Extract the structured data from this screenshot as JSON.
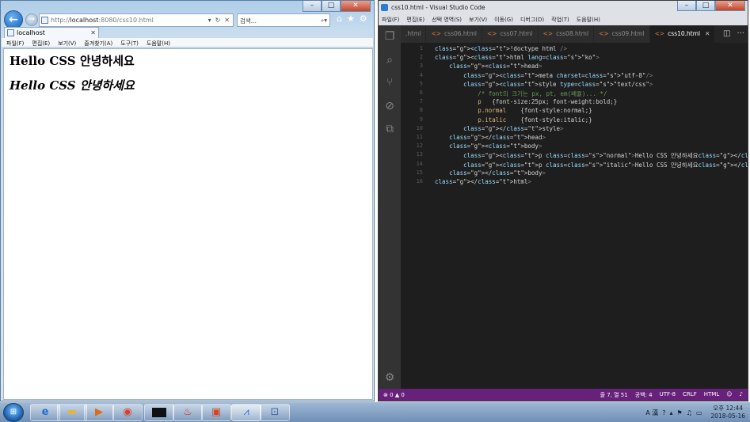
{
  "ie": {
    "address": {
      "prefix": "http://",
      "host": "localhost",
      "rest": ":8080/css10.html"
    },
    "search_placeholder": "검색...",
    "tab_title": "localhost",
    "menu": [
      "파일(F)",
      "편집(E)",
      "보기(V)",
      "즐겨찾기(A)",
      "도구(T)",
      "도움말(H)"
    ],
    "content": {
      "normal_text": "Hello CSS 안녕하세요",
      "italic_text": "Hello CSS 안녕하세요"
    }
  },
  "vscode": {
    "title": "css10.html - Visual Studio Code",
    "menu": [
      "파일(F)",
      "편집(E)",
      "선택 영역(S)",
      "보기(V)",
      "이동(G)",
      "디버그(D)",
      "작업(T)",
      "도움말(H)"
    ],
    "tabs": [
      {
        "label": ".html",
        "icon": "<>"
      },
      {
        "label": "css06.html",
        "icon": "<>"
      },
      {
        "label": "css07.html",
        "icon": "<>"
      },
      {
        "label": "css08.html",
        "icon": "<>"
      },
      {
        "label": "css09.html",
        "icon": "<>"
      },
      {
        "label": "css10.html",
        "icon": "<>",
        "active": true
      }
    ],
    "line_numbers": [
      "1",
      "2",
      "3",
      "4",
      "5",
      "6",
      "7",
      "8",
      "9",
      "10",
      "11",
      "12",
      "13",
      "14",
      "15",
      "16"
    ],
    "code_lines": [
      "<!doctype html />",
      "<html lang=\"ko\">",
      "    <head>",
      "        <meta charset=\"utf-8\"/>",
      "        <style type=\"text/css\">",
      "            /* font의 크기는 px, pt, em(배율)... */",
      "            p   {font-size:25px; font-weight:bold;}",
      "            p.normal    {font-style:normal;}",
      "            p.italic    {font-style:italic;}",
      "        </style>",
      "    </head>",
      "    <body>",
      "        <p class=\"normal\">Hello CSS 안녕하세요</p>",
      "        <p class=\"italic\">Hello CSS 안녕하세요</p>",
      "    </body>",
      "</html>"
    ],
    "status": {
      "problems": "⊗ 0 ▲ 0",
      "position": "줄 7, 열 51",
      "spaces": "공백: 4",
      "encoding": "UTF-8",
      "eol": "CRLF",
      "language": "HTML"
    }
  },
  "taskbar": {
    "apps": [
      "internet-explorer",
      "file-explorer",
      "media-player",
      "chrome",
      "command-prompt",
      "java",
      "powerpoint",
      "vscode",
      "network"
    ],
    "tray_lang": "A 漢",
    "clock_time": "오후 12:44",
    "clock_date": "2018-05-16"
  }
}
